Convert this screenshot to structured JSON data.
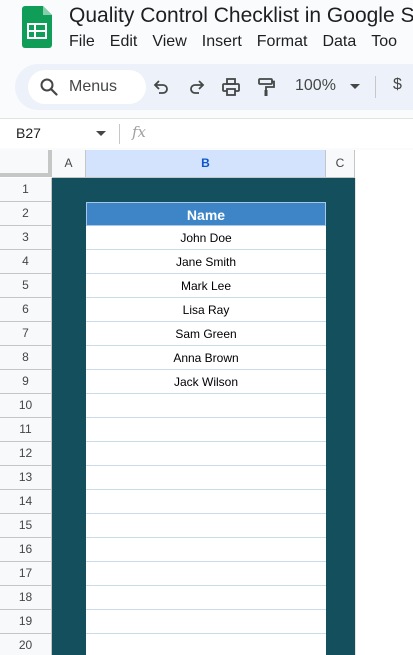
{
  "app": {
    "title": "Quality Control Checklist in Google Sh",
    "menu": [
      "File",
      "Edit",
      "View",
      "Insert",
      "Format",
      "Data",
      "Too"
    ]
  },
  "toolbar": {
    "search_label": "Menus",
    "zoom": "100%",
    "currency": "$"
  },
  "formula_bar": {
    "cell_ref": "B27",
    "fx": "fx"
  },
  "sheet": {
    "columns": [
      "A",
      "B",
      "C"
    ],
    "selected_column": "B",
    "rows": [
      "1",
      "2",
      "3",
      "4",
      "5",
      "6",
      "7",
      "8",
      "9",
      "10",
      "11",
      "12",
      "13",
      "14",
      "15",
      "16",
      "17",
      "18",
      "19",
      "20"
    ],
    "table_header": "Name",
    "names": [
      "John Doe",
      "Jane Smith",
      "Mark Lee",
      "Lisa Ray",
      "Sam Green",
      "Anna Brown",
      "Jack Wilson",
      "",
      "",
      "",
      "",
      "",
      "",
      "",
      "",
      "",
      "",
      ""
    ]
  },
  "colors": {
    "teal_block": "#134f5c",
    "header_blue": "#3d85c6",
    "selected_column": "#d3e3fd"
  }
}
